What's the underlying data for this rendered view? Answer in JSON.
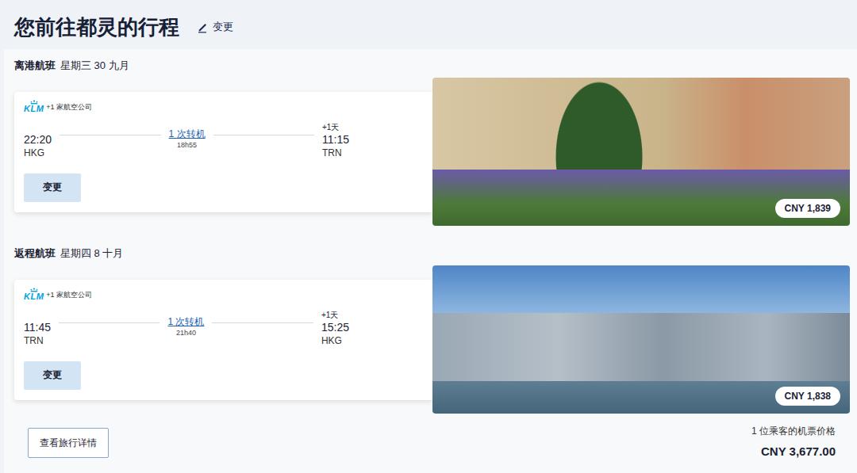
{
  "title": "您前往都灵的行程",
  "edit_link": "变更",
  "flights": [
    {
      "heading": "离港航班",
      "date": "星期三 30 九月",
      "airline_logo": "KLM",
      "airline_extra": "+1 家航空公司",
      "depart_time": "22:20",
      "depart_airport": "HKG",
      "stops": "1 次转机",
      "duration": "18h55",
      "day_offset": "+1天",
      "arrive_time": "11:15",
      "arrive_airport": "TRN",
      "change_button": "变更",
      "price": "CNY 1,839",
      "photo": "turin"
    },
    {
      "heading": "返程航班",
      "date": "星期四 8 十月",
      "airline_logo": "KLM",
      "airline_extra": "+1 家航空公司",
      "depart_time": "11:45",
      "depart_airport": "TRN",
      "stops": "1 次转机",
      "duration": "21h40",
      "day_offset": "+1天",
      "arrive_time": "15:25",
      "arrive_airport": "HKG",
      "change_button": "变更",
      "price": "CNY 1,838",
      "photo": "hongkong"
    }
  ],
  "details_button": "查看旅行详情",
  "total": {
    "label": "1 位乘客的机票价格",
    "price": "CNY 3,677.00"
  }
}
